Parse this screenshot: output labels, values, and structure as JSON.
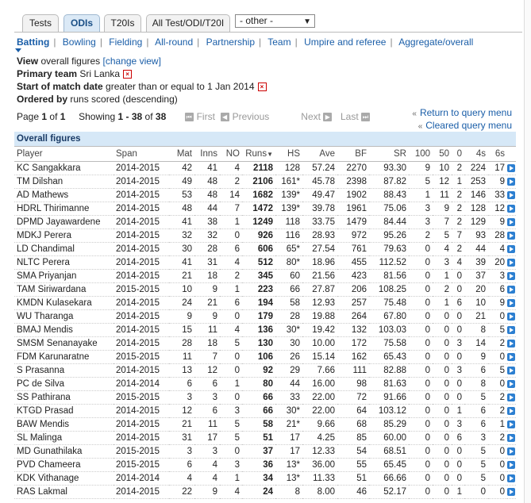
{
  "tabs": [
    {
      "label": "Tests",
      "active": false
    },
    {
      "label": "ODIs",
      "active": true
    },
    {
      "label": "T20Is",
      "active": false
    },
    {
      "label": "All Test/ODI/T20I",
      "active": false
    }
  ],
  "format_select": {
    "value": "- other -"
  },
  "subnav": [
    "Batting",
    "Bowling",
    "Fielding",
    "All-round",
    "Partnership",
    "Team",
    "Umpire and referee",
    "Aggregate/overall"
  ],
  "query": {
    "view_label": "View",
    "view_value": "overall figures",
    "change_view": "[change view]",
    "team_label": "Primary team",
    "team_value": "Sri Lanka",
    "date_label": "Start of match date",
    "date_value": "greater than or equal to 1 Jan 2014",
    "order_label": "Ordered by",
    "order_value": "runs scored (descending)"
  },
  "pager": {
    "page_text": "Page",
    "page": "1",
    "of_text": "of",
    "pages": "1",
    "showing_text": "Showing",
    "range": "1 - 38",
    "total_of": "of",
    "total": "38",
    "first": "First",
    "previous": "Previous",
    "next": "Next",
    "last": "Last"
  },
  "links": {
    "return": "Return to query menu",
    "cleared": "Cleared query menu"
  },
  "table": {
    "caption": "Overall figures",
    "columns": [
      "Player",
      "Span",
      "Mat",
      "Inns",
      "NO",
      "Runs",
      "HS",
      "Ave",
      "BF",
      "SR",
      "100",
      "50",
      "0",
      "4s",
      "6s"
    ],
    "rows": [
      [
        "KC Sangakkara",
        "2014-2015",
        "42",
        "41",
        "4",
        "2118",
        "128",
        "57.24",
        "2270",
        "93.30",
        "9",
        "10",
        "2",
        "224",
        "17"
      ],
      [
        "TM Dilshan",
        "2014-2015",
        "49",
        "48",
        "2",
        "2106",
        "161*",
        "45.78",
        "2398",
        "87.82",
        "5",
        "12",
        "1",
        "253",
        "9"
      ],
      [
        "AD Mathews",
        "2014-2015",
        "53",
        "48",
        "14",
        "1682",
        "139*",
        "49.47",
        "1902",
        "88.43",
        "1",
        "11",
        "2",
        "146",
        "33"
      ],
      [
        "HDRL Thirimanne",
        "2014-2015",
        "48",
        "44",
        "7",
        "1472",
        "139*",
        "39.78",
        "1961",
        "75.06",
        "3",
        "9",
        "2",
        "128",
        "12"
      ],
      [
        "DPMD Jayawardene",
        "2014-2015",
        "41",
        "38",
        "1",
        "1249",
        "118",
        "33.75",
        "1479",
        "84.44",
        "3",
        "7",
        "2",
        "129",
        "9"
      ],
      [
        "MDKJ Perera",
        "2014-2015",
        "32",
        "32",
        "0",
        "926",
        "116",
        "28.93",
        "972",
        "95.26",
        "2",
        "5",
        "7",
        "93",
        "28"
      ],
      [
        "LD Chandimal",
        "2014-2015",
        "30",
        "28",
        "6",
        "606",
        "65*",
        "27.54",
        "761",
        "79.63",
        "0",
        "4",
        "2",
        "44",
        "4"
      ],
      [
        "NLTC Perera",
        "2014-2015",
        "41",
        "31",
        "4",
        "512",
        "80*",
        "18.96",
        "455",
        "112.52",
        "0",
        "3",
        "4",
        "39",
        "20"
      ],
      [
        "SMA Priyanjan",
        "2014-2015",
        "21",
        "18",
        "2",
        "345",
        "60",
        "21.56",
        "423",
        "81.56",
        "0",
        "1",
        "0",
        "37",
        "3"
      ],
      [
        "TAM Siriwardana",
        "2015-2015",
        "10",
        "9",
        "1",
        "223",
        "66",
        "27.87",
        "206",
        "108.25",
        "0",
        "2",
        "0",
        "20",
        "6"
      ],
      [
        "KMDN Kulasekara",
        "2014-2015",
        "24",
        "21",
        "6",
        "194",
        "58",
        "12.93",
        "257",
        "75.48",
        "0",
        "1",
        "6",
        "10",
        "9"
      ],
      [
        "WU Tharanga",
        "2014-2015",
        "9",
        "9",
        "0",
        "179",
        "28",
        "19.88",
        "264",
        "67.80",
        "0",
        "0",
        "0",
        "21",
        "0"
      ],
      [
        "BMAJ Mendis",
        "2014-2015",
        "15",
        "11",
        "4",
        "136",
        "30*",
        "19.42",
        "132",
        "103.03",
        "0",
        "0",
        "0",
        "8",
        "5"
      ],
      [
        "SMSM Senanayake",
        "2014-2015",
        "28",
        "18",
        "5",
        "130",
        "30",
        "10.00",
        "172",
        "75.58",
        "0",
        "0",
        "3",
        "14",
        "2"
      ],
      [
        "FDM Karunaratne",
        "2015-2015",
        "11",
        "7",
        "0",
        "106",
        "26",
        "15.14",
        "162",
        "65.43",
        "0",
        "0",
        "0",
        "9",
        "0"
      ],
      [
        "S Prasanna",
        "2014-2015",
        "13",
        "12",
        "0",
        "92",
        "29",
        "7.66",
        "111",
        "82.88",
        "0",
        "0",
        "3",
        "6",
        "5"
      ],
      [
        "PC de Silva",
        "2014-2014",
        "6",
        "6",
        "1",
        "80",
        "44",
        "16.00",
        "98",
        "81.63",
        "0",
        "0",
        "0",
        "8",
        "0"
      ],
      [
        "SS Pathirana",
        "2015-2015",
        "3",
        "3",
        "0",
        "66",
        "33",
        "22.00",
        "72",
        "91.66",
        "0",
        "0",
        "0",
        "5",
        "2"
      ],
      [
        "KTGD Prasad",
        "2014-2015",
        "12",
        "6",
        "3",
        "66",
        "30*",
        "22.00",
        "64",
        "103.12",
        "0",
        "0",
        "1",
        "6",
        "2"
      ],
      [
        "BAW Mendis",
        "2014-2015",
        "21",
        "11",
        "5",
        "58",
        "21*",
        "9.66",
        "68",
        "85.29",
        "0",
        "0",
        "3",
        "6",
        "1"
      ],
      [
        "SL Malinga",
        "2014-2015",
        "31",
        "17",
        "5",
        "51",
        "17",
        "4.25",
        "85",
        "60.00",
        "0",
        "0",
        "6",
        "3",
        "2"
      ],
      [
        "MD Gunathilaka",
        "2015-2015",
        "3",
        "3",
        "0",
        "37",
        "17",
        "12.33",
        "54",
        "68.51",
        "0",
        "0",
        "0",
        "5",
        "0"
      ],
      [
        "PVD Chameera",
        "2015-2015",
        "6",
        "4",
        "3",
        "36",
        "13*",
        "36.00",
        "55",
        "65.45",
        "0",
        "0",
        "0",
        "5",
        "0"
      ],
      [
        "KDK Vithanage",
        "2014-2014",
        "4",
        "4",
        "1",
        "34",
        "13*",
        "11.33",
        "51",
        "66.66",
        "0",
        "0",
        "0",
        "5",
        "0"
      ],
      [
        "RAS Lakmal",
        "2014-2015",
        "22",
        "9",
        "4",
        "24",
        "8",
        "8.00",
        "46",
        "52.17",
        "0",
        "0",
        "1",
        "0",
        "0"
      ]
    ]
  }
}
